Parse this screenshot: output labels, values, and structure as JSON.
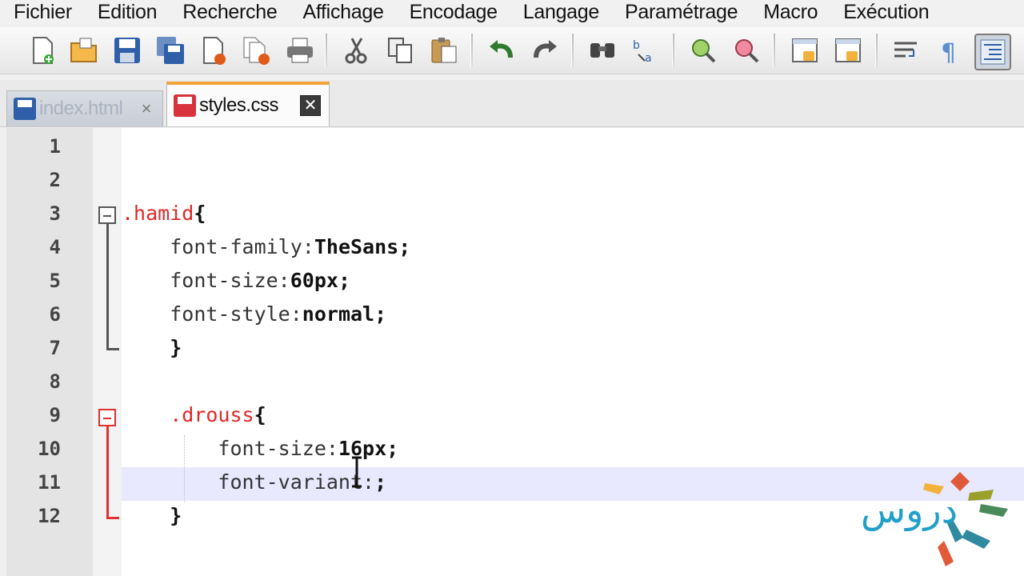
{
  "menu": {
    "items": [
      "Fichier",
      "Edition",
      "Recherche",
      "Affichage",
      "Encodage",
      "Langage",
      "Paramétrage",
      "Macro",
      "Exécution"
    ]
  },
  "toolbar": {
    "buttons": [
      "new-file-icon",
      "open-file-icon",
      "save-icon",
      "save-all-icon",
      "close-icon",
      "close-all-icon",
      "print-icon",
      "cut-icon",
      "copy-icon",
      "paste-icon",
      "undo-icon",
      "redo-icon",
      "find-icon",
      "replace-icon",
      "zoom-in-icon",
      "zoom-out-icon",
      "sync-vertical-icon",
      "sync-horizontal-icon",
      "word-wrap-icon",
      "show-all-chars-icon",
      "indent-guide-icon"
    ]
  },
  "tabs": [
    {
      "label": "index.html",
      "close": "×",
      "active": false
    },
    {
      "label": "styles.css",
      "close": "✕",
      "active": true
    }
  ],
  "editor": {
    "current_line": 11,
    "lines": [
      {
        "no": "1",
        "indent": "",
        "sel": "",
        "prop": "",
        "val": "",
        "punct": ""
      },
      {
        "no": "2",
        "indent": "",
        "sel": "",
        "prop": "",
        "val": "",
        "punct": ""
      },
      {
        "no": "3",
        "indent": "",
        "sel": ".hamid",
        "prop": "",
        "val": "",
        "punct": "{"
      },
      {
        "no": "4",
        "indent": "    ",
        "sel": "",
        "prop": "font-family:",
        "val": "TheSans",
        "punct": ";"
      },
      {
        "no": "5",
        "indent": "    ",
        "sel": "",
        "prop": "font-size:",
        "val": "60px",
        "punct": ";"
      },
      {
        "no": "6",
        "indent": "    ",
        "sel": "",
        "prop": "font-style:",
        "val": "normal",
        "punct": ";"
      },
      {
        "no": "7",
        "indent": "    ",
        "sel": "",
        "prop": "",
        "val": "",
        "punct": "}"
      },
      {
        "no": "8",
        "indent": "",
        "sel": "",
        "prop": "",
        "val": "",
        "punct": ""
      },
      {
        "no": "9",
        "indent": "    ",
        "sel": ".drouss",
        "prop": "",
        "val": "",
        "punct": "{"
      },
      {
        "no": "10",
        "indent": "        ",
        "sel": "",
        "prop": "font-size:",
        "val": "16px",
        "punct": ";"
      },
      {
        "no": "11",
        "indent": "        ",
        "sel": "",
        "prop": "font-variant:",
        "val": "",
        "punct": ";"
      },
      {
        "no": "12",
        "indent": "    ",
        "sel": "",
        "prop": "",
        "val": "",
        "punct": "}"
      }
    ]
  },
  "logo": {
    "text": "دروس"
  },
  "colors": {
    "selector": "#e02828",
    "tab_accent": "#f2a338",
    "current_line": "#e8e8ff",
    "logo_blue": "#1f9fc9"
  }
}
